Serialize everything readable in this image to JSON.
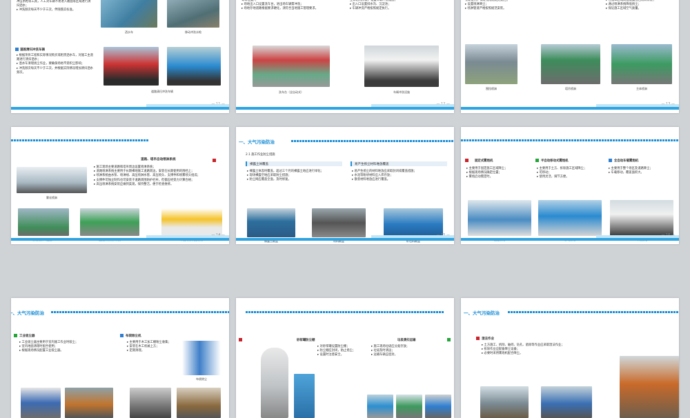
{
  "slides": {
    "s1": {
      "text1": "冲压水枪等工具，人工对车辆不易进入路面等区域进行清扫洒水；\n▸ 冲洗频次每天不少于三次，伴随落实标准。",
      "cap_a": "洒水车",
      "cap_b": "移动冲洗水枪",
      "heading": "道路清扫冲洗车辆",
      "text2": "▸ 根据项目工程和实际情况购买或租赁洒水车，对施工主道路进行清扫洒水；\n▸ 洒水车清理扬尘作业，要确保场地不受积尘影响；\n▸ 冲洗频次每天不少于三次，并根据实际情况增加清扫洒水频次。",
      "cap_c": "道路清扫冲洗车辆",
      "page": "— 11 —"
    },
    "s2": {
      "text1": "等等位置）；\n▸ 场地出入口设置洗车台，进出场车辆需冲洗；\n▸ 场地存地道路根据要求硬化，须符合当地施工管理要求。",
      "text2": "主体结构阶段，设置车辆冲洗设施；\n▸ 出入口设置排水沟、沉淀池；\n▸ 车辆冲洗严格按照规定执行。",
      "cap_a": "洗车台（全自动式）",
      "cap_b": "车辆冲洗设施",
      "page": "— 12 —"
    },
    "s3": {
      "text1": "长期使用，保证视线通透无遮挡；\n▸ 设置喷淋降尘；\n▸ 喷淋管道严格按照规范安装。",
      "text2": "▸ 在施工区域周边设置围挡喷淋系统；\n▸ 通过喷淋系统降低扬尘；\n▸ 保证施工区域空气质量。",
      "cap_a": "围挡喷淋",
      "cap_b": "塔吊喷淋",
      "cap_c": "主体喷淋",
      "page": "— 13 —"
    },
    "s4": {
      "heading": "道路、塔吊自动喷淋系统",
      "text1": "▸ 施工现场主要道路和塔吊周边设置喷淋系统；\n▸ 道路喷淋系统主要用于长期裸地施工道路周边，安装在长期使用的围挡上；\n▸ 喷淋系统由水泵、喷淋线、高压喷淋水管、高压喷头、支撑件和喷雾喷头组成；\n▸ 支撑件可独立制作也可安装于道路周围防护栏杆，但都应经受力计算合格；\n▸ 高压喷淋系统安装应做到美观，保持整洁，便于检查维修。",
      "cap_a": "雾化喷淋",
      "cap_b": "雾化喷淋（道路）",
      "cap_c": "围挡安装喷淋系统",
      "cap_d": "高压喷雾机控制柜",
      "page": "— 14 —"
    },
    "s5": {
      "title": "一、大气污染防治",
      "section": "2.1 施工作业防尘措施",
      "h_left": "裸露土体覆盖",
      "h_right": "易产生扬尘材料堆放覆盖",
      "text_left": "▸ 裸露土体及时覆盖，超过三个月的裸露土地应进行绿化；\n▸ 现场裸露空地应采取防尘措施；\n▸ 防尘网应覆盖全面，及时修复。",
      "text_right": "▸ 易产生扬尘的材料堆放应采取封闭或覆盖措施；\n▸ 水泥等粉状材料应入库存放；\n▸ 散装材料堆放应进行覆盖。",
      "cap_a": "裸露土覆盖",
      "cap_b": "材料覆盖",
      "cap_c": "砂石料覆盖",
      "page": "— 15 —"
    },
    "s6": {
      "h1": "固定式雾炮机",
      "h2": "半自动移动式雾炮机",
      "h3": "全自动车载雾炮机",
      "t1": "▸ 主要用于固定施工区域降尘；\n▸ 根据现场情况确定位置；\n▸ 雾炮启动需定时。",
      "t2": "▸ 主要用于土方、拆除施工区域降尘；\n▸ 可移动；\n▸ 使用灵活，调节方便。",
      "t3": "▸ 主要用于整个场区及道路降尘；\n▸ 车载移动，覆盖面积大。",
      "cap_a": "固定雾炮",
      "cap_b": "移动雾炮",
      "cap_c": "车载雾炮",
      "page": "— 16 —"
    },
    "s7": {
      "title": "一、大气污染防治",
      "h1": "工业吸尘器",
      "h2": "布袋除尘机",
      "t1": "▸ 工业吸尘器主要用于室内施工作业时吸尘；\n▸ 室内地面清理时配合使用；\n▸ 根据现场情况配置工业吸尘器。",
      "t2": "▸ 主要用于木工加工棚粉尘收集；\n▸ 安装在木工机械上方；\n▸ 定期清理。",
      "cap_a": "布袋除尘"
    },
    "s8": {
      "h1": "砂浆罐防尘棚",
      "h2": "垃圾清扫运输",
      "t1": "▸ 对砂浆罐设置防尘棚；\n▸ 防尘棚应封闭，防止扬尘；\n▸ 设置时注意安全。",
      "t2": "▸ 施工现场垃圾应分类存放；\n▸ 垃圾及时清运；\n▸ 运输车辆应密封。"
    },
    "s9": {
      "title": "一、大气污染防治",
      "h1": "湿法作业",
      "t1": "▸ 土方施工、拆除、破碎、钻孔、凿除等作业应采取湿法作业；\n▸ 拆除作业应配备降尘设备；\n▸ 必要时采用雾炮机配合降尘。"
    }
  }
}
